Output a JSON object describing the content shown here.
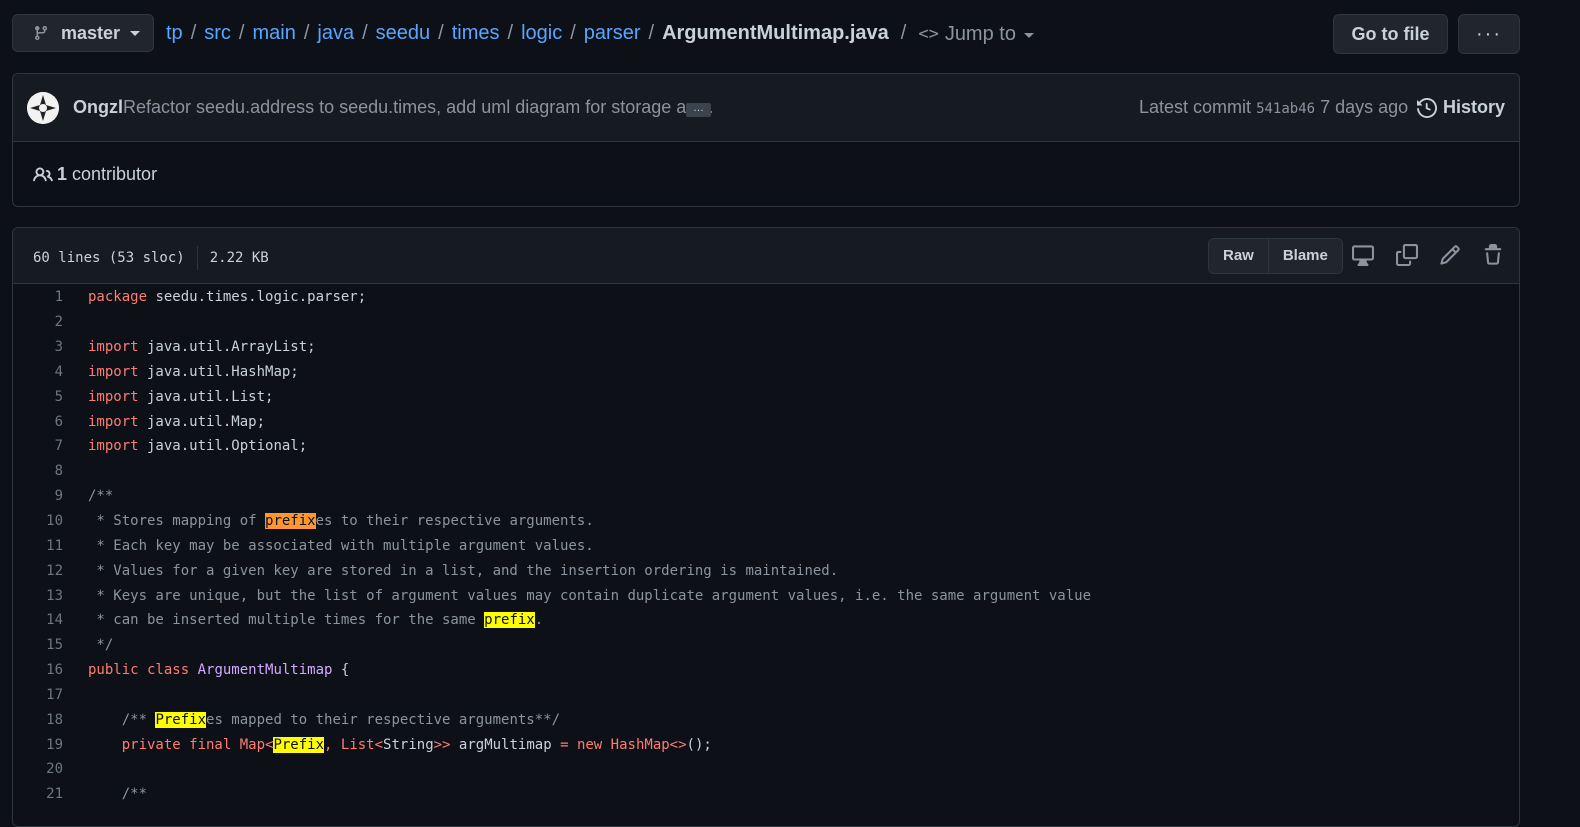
{
  "branch": {
    "label": "master"
  },
  "breadcrumb": {
    "parts": [
      "tp",
      "src",
      "main",
      "java",
      "seedu",
      "times",
      "logic",
      "parser"
    ],
    "file": "ArgumentMultimap.java",
    "jump_label": "Jump to"
  },
  "buttons": {
    "go_to_file": "Go to file",
    "more": "···"
  },
  "commit": {
    "author": "Ongzl",
    "message": "Refactor seedu.address to seedu.times, add uml diagram for storage an…",
    "ellipsis": "…",
    "latest_label": "Latest commit",
    "sha": "541ab46",
    "age": "7 days ago",
    "history_label": "History"
  },
  "contributors": {
    "count": "1",
    "label": "contributor"
  },
  "file": {
    "lines_info": "60 lines (53 sloc)",
    "size": "2.22 KB",
    "raw_label": "Raw",
    "blame_label": "Blame"
  },
  "code_lines": [
    {
      "n": "1",
      "tokens": [
        {
          "t": "package",
          "c": "kw"
        },
        {
          "t": " seedu.times.logic.parser;",
          "c": ""
        }
      ]
    },
    {
      "n": "2",
      "tokens": []
    },
    {
      "n": "3",
      "tokens": [
        {
          "t": "import",
          "c": "kw"
        },
        {
          "t": " java.util.ArrayList;",
          "c": ""
        }
      ]
    },
    {
      "n": "4",
      "tokens": [
        {
          "t": "import",
          "c": "kw"
        },
        {
          "t": " java.util.HashMap;",
          "c": ""
        }
      ]
    },
    {
      "n": "5",
      "tokens": [
        {
          "t": "import",
          "c": "kw"
        },
        {
          "t": " java.util.List;",
          "c": ""
        }
      ]
    },
    {
      "n": "6",
      "tokens": [
        {
          "t": "import",
          "c": "kw"
        },
        {
          "t": " java.util.Map;",
          "c": ""
        }
      ]
    },
    {
      "n": "7",
      "tokens": [
        {
          "t": "import",
          "c": "kw"
        },
        {
          "t": " java.util.Optional;",
          "c": ""
        }
      ]
    },
    {
      "n": "8",
      "tokens": []
    },
    {
      "n": "9",
      "tokens": [
        {
          "t": "/**",
          "c": "cm"
        }
      ]
    },
    {
      "n": "10",
      "tokens": [
        {
          "t": " * Stores mapping of ",
          "c": "cm"
        },
        {
          "t": "prefix",
          "c": "hl-cur"
        },
        {
          "t": "es to their respective arguments.",
          "c": "cm"
        }
      ]
    },
    {
      "n": "11",
      "tokens": [
        {
          "t": " * Each key may be associated with multiple argument values.",
          "c": "cm"
        }
      ]
    },
    {
      "n": "12",
      "tokens": [
        {
          "t": " * Values for a given key are stored in a list, and the insertion ordering is maintained.",
          "c": "cm"
        }
      ]
    },
    {
      "n": "13",
      "tokens": [
        {
          "t": " * Keys are unique, but the list of argument values may contain duplicate argument values, i.e. the same argument value",
          "c": "cm"
        }
      ]
    },
    {
      "n": "14",
      "tokens": [
        {
          "t": " * can be inserted multiple times for the same ",
          "c": "cm"
        },
        {
          "t": "prefix",
          "c": "hl"
        },
        {
          "t": ".",
          "c": "cm"
        }
      ]
    },
    {
      "n": "15",
      "tokens": [
        {
          "t": " */",
          "c": "cm"
        }
      ]
    },
    {
      "n": "16",
      "tokens": [
        {
          "t": "public class",
          "c": "kw"
        },
        {
          "t": " ",
          "c": ""
        },
        {
          "t": "ArgumentMultimap",
          "c": "cls"
        },
        {
          "t": " {",
          "c": ""
        }
      ]
    },
    {
      "n": "17",
      "tokens": []
    },
    {
      "n": "18",
      "tokens": [
        {
          "t": "    /** ",
          "c": "cm"
        },
        {
          "t": "Prefix",
          "c": "hl"
        },
        {
          "t": "es mapped to their respective arguments**/",
          "c": "cm"
        }
      ]
    },
    {
      "n": "19",
      "tokens": [
        {
          "t": "    private final",
          "c": "kw"
        },
        {
          "t": " ",
          "c": ""
        },
        {
          "t": "Map<",
          "c": "kw"
        },
        {
          "t": "Prefix",
          "c": "hl"
        },
        {
          "t": ", ",
          "c": "kw"
        },
        {
          "t": "List<",
          "c": "kw"
        },
        {
          "t": "String",
          "c": ""
        },
        {
          "t": ">>",
          "c": "kw"
        },
        {
          "t": " argMultimap ",
          "c": ""
        },
        {
          "t": "=",
          "c": "kw"
        },
        {
          "t": " ",
          "c": ""
        },
        {
          "t": "new",
          "c": "kw"
        },
        {
          "t": " ",
          "c": ""
        },
        {
          "t": "HashMap<>",
          "c": "kw"
        },
        {
          "t": "();",
          "c": ""
        }
      ]
    },
    {
      "n": "20",
      "tokens": []
    },
    {
      "n": "21",
      "tokens": [
        {
          "t": "    /**",
          "c": "cm"
        }
      ]
    }
  ]
}
